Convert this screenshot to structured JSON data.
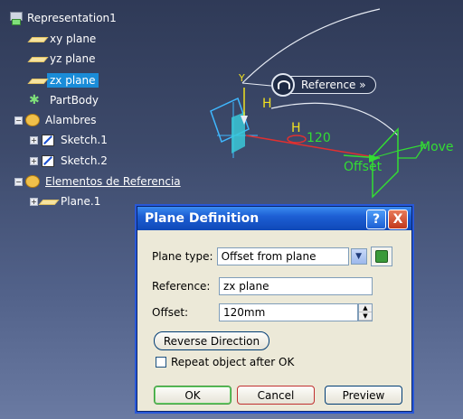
{
  "tree": {
    "root": "Representation1",
    "items": [
      {
        "label": "xy plane",
        "kind": "plane"
      },
      {
        "label": "yz plane",
        "kind": "plane"
      },
      {
        "label": "zx plane",
        "kind": "plane",
        "selected": true
      },
      {
        "label": "PartBody",
        "kind": "partbody"
      },
      {
        "label": "Alambres",
        "kind": "set"
      },
      {
        "label": "Sketch.1",
        "kind": "sketch"
      },
      {
        "label": "Sketch.2",
        "kind": "sketch"
      },
      {
        "label": "Elementos de Referencia",
        "kind": "set"
      },
      {
        "label": "Plane.1",
        "kind": "plane"
      }
    ]
  },
  "viewport": {
    "reference_label": "Reference »",
    "h_label_1": "H",
    "h_label_2": "H",
    "dimension": "120",
    "offset_label": "Offset",
    "move_label": "Move"
  },
  "dialog": {
    "title": "Plane Definition",
    "help": "?",
    "close": "X",
    "plane_type_label": "Plane type:",
    "plane_type_value": "Offset from plane",
    "reference_label": "Reference:",
    "reference_value": "zx plane",
    "offset_label": "Offset:",
    "offset_value": "120mm",
    "reverse_label": "Reverse Direction",
    "repeat_label": "Repeat object after OK",
    "ok_label": "OK",
    "cancel_label": "Cancel",
    "preview_label": "Preview"
  },
  "colors": {
    "selection": "#1a8cd8",
    "dimension": "#e03030",
    "offset": "#33dd33",
    "handle": "#f0e020"
  }
}
